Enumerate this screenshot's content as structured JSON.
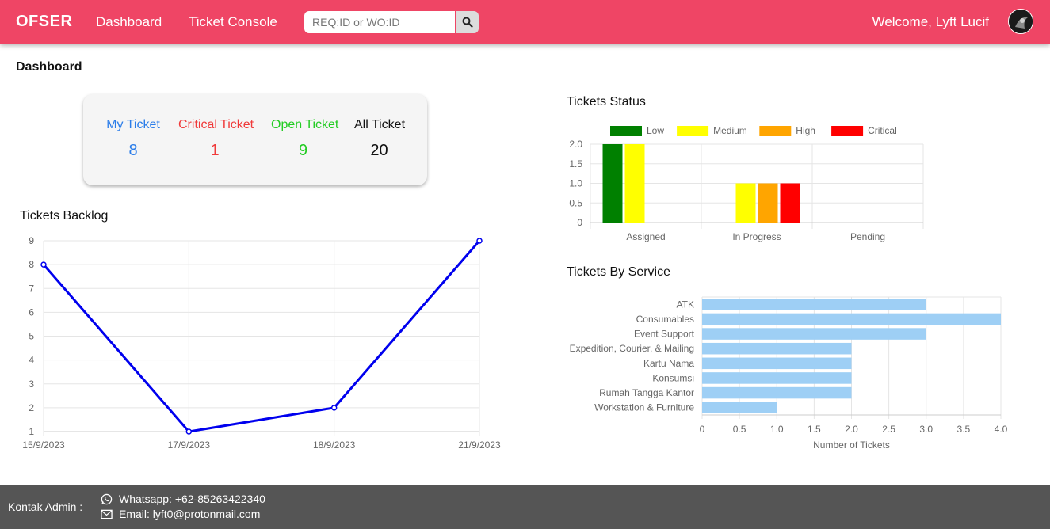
{
  "navbar": {
    "brand": "OFSER",
    "links": [
      "Dashboard",
      "Ticket Console"
    ],
    "search_placeholder": "REQ:ID or WO:ID",
    "welcome": "Welcome, Lyft Lucif"
  },
  "page_title": "Dashboard",
  "summary": [
    {
      "label": "My Ticket",
      "value": "8",
      "color": "#2b7de9"
    },
    {
      "label": "Critical Ticket",
      "value": "1",
      "color": "#f03a3a"
    },
    {
      "label": "Open Ticket",
      "value": "9",
      "color": "#22cc22"
    },
    {
      "label": "All Ticket",
      "value": "20",
      "color": "#111111"
    }
  ],
  "sections": {
    "backlog": "Tickets Backlog",
    "status": "Tickets Status",
    "service": "Tickets By Service"
  },
  "chart_data": [
    {
      "type": "line",
      "x": [
        "15/9/2023",
        "17/9/2023",
        "18/9/2023",
        "21/9/2023"
      ],
      "series": [
        {
          "values": [
            8,
            1,
            2,
            9
          ],
          "color": "#0000ee"
        }
      ],
      "ylim": [
        1,
        9
      ],
      "yticks": [
        1,
        2,
        3,
        4,
        5,
        6,
        7,
        8,
        9
      ],
      "grid": true
    },
    {
      "type": "bar",
      "categories": [
        "Assigned",
        "In Progress",
        "Pending"
      ],
      "series": [
        {
          "name": "Low",
          "values": [
            2,
            0,
            0
          ],
          "color": "#008000"
        },
        {
          "name": "Medium",
          "values": [
            2,
            1,
            0
          ],
          "color": "#ffff00"
        },
        {
          "name": "High",
          "values": [
            0,
            1,
            0
          ],
          "color": "#ffa500"
        },
        {
          "name": "Critical",
          "values": [
            0,
            1,
            0
          ],
          "color": "#ff0000"
        }
      ],
      "ylim": [
        0,
        2
      ],
      "yticks": [
        "0",
        "0.5",
        "1.0",
        "1.5",
        "2.0"
      ],
      "legend": "top"
    },
    {
      "type": "bar",
      "orientation": "horizontal",
      "categories": [
        "ATK",
        "Consumables",
        "Event Support",
        "Expedition, Courier, & Mailing",
        "Kartu Nama",
        "Konsumsi",
        "Rumah Tangga Kantor",
        "Workstation & Furniture"
      ],
      "values": [
        3,
        4,
        3,
        2,
        2,
        2,
        2,
        1
      ],
      "color": "#9ecff5",
      "xlabel": "Number of Tickets",
      "xlim": [
        0,
        4
      ],
      "xticks": [
        "0",
        "0.5",
        "1.0",
        "1.5",
        "2.0",
        "2.5",
        "3.0",
        "3.5",
        "4.0"
      ]
    }
  ],
  "footer": {
    "label": "Kontak Admin :",
    "whatsapp": "Whatsapp: +62-85263422340",
    "email": "Email: lyft0@protonmail.com"
  }
}
